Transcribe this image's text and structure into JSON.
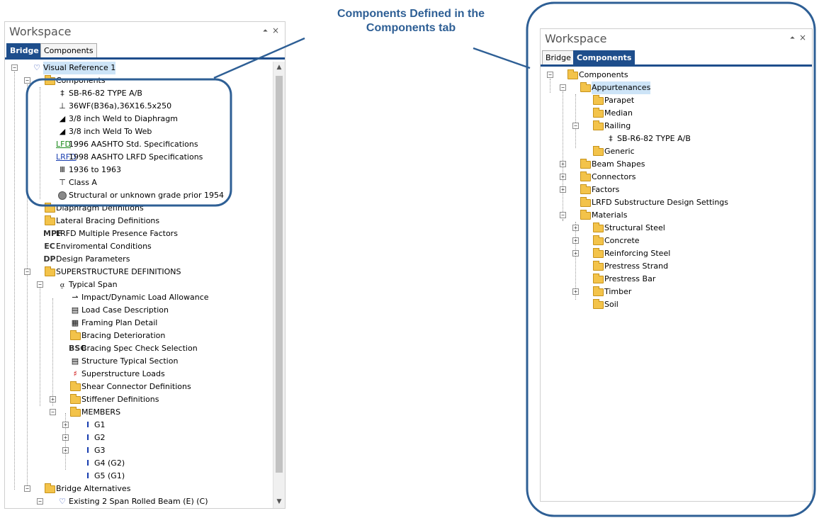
{
  "callout": {
    "line1": "Components Defined in the",
    "line2": "Components tab",
    "color": "#2e5f95"
  },
  "accent_color": "#1e4e8c",
  "left_panel": {
    "title": "Workspace",
    "pin_icon": "pin-icon",
    "close_label": "×",
    "tabs": [
      {
        "label": "Bridge",
        "active": true
      },
      {
        "label": "Components",
        "active": false
      }
    ],
    "tree": {
      "root": "Visual Reference 1",
      "components": "Components",
      "component_items": [
        "SB-R6-82 TYPE A/B",
        "36WF(B36a),36X16.5x250",
        "3/8 inch Weld to Diaphragm",
        "3/8 inch Weld To Web",
        "1996 AASHTO Std. Specifications",
        "1998 AASHTO LRFD Specifications",
        "1936  to 1963",
        "Class A",
        "Structural or unknown grade prior 1954"
      ],
      "icon_text": {
        "lfd": "LFD",
        "lrfd": "LRFD",
        "mpf": "MPF",
        "ec": "EC",
        "dp": "DP",
        "bsc": "BSC",
        "member": "I"
      },
      "diaphragm": "Diaphragm Definitions",
      "lateral": "Lateral Bracing Definitions",
      "lrfd_mpf": "LRFD Multiple Presence Factors",
      "env": "Enviromental Conditions",
      "design": "Design Parameters",
      "superstructure": "SUPERSTRUCTURE DEFINITIONS",
      "typical_span": "Typical Span",
      "span_items": [
        "Impact/Dynamic Load Allowance",
        "Load Case Description",
        "Framing Plan Detail",
        "Bracing Deterioration",
        "Bracing Spec Check Selection",
        "Structure Typical Section",
        "Superstructure Loads",
        "Shear Connector Definitions",
        "Stiffener Definitions"
      ],
      "members": "MEMBERS",
      "member_items": [
        "G1",
        "G2",
        "G3",
        "G4 (G2)",
        "G5 (G1)"
      ],
      "bridge_alternatives": "Bridge Alternatives",
      "existing": "Existing 2 Span Rolled Beam  (E)  (C)"
    }
  },
  "right_panel": {
    "title": "Workspace",
    "pin_icon": "pin-icon",
    "close_label": "×",
    "tabs": [
      {
        "label": "Bridge",
        "active": false
      },
      {
        "label": "Components",
        "active": true
      }
    ],
    "tree": {
      "root": "Components",
      "appurtenances": "Appurtenances",
      "parapet": "Parapet",
      "median": "Median",
      "railing": "Railing",
      "railing_item": "SB-R6-82 TYPE A/B",
      "generic": "Generic",
      "beam_shapes": "Beam Shapes",
      "connectors": "Connectors",
      "factors": "Factors",
      "lrfd_sub": "LRFD Substructure Design Settings",
      "materials": "Materials",
      "material_items": [
        "Structural Steel",
        "Concrete",
        "Reinforcing Steel",
        "Prestress Strand",
        "Prestress Bar",
        "Timber",
        "Soil"
      ]
    }
  }
}
